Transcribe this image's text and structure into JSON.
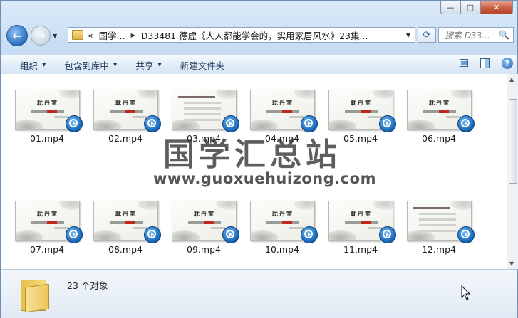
{
  "window": {
    "minimize": "—",
    "maximize": "□",
    "close": "✕"
  },
  "nav": {
    "back_glyph": "←",
    "forward_glyph": "→",
    "history_dropdown": "▼"
  },
  "address": {
    "overflow": "«",
    "segments": [
      "国学...",
      "D33481 德虚《人人都能学会的，实用家居风水》23集..."
    ],
    "separator": "▶",
    "dropdown": "▼"
  },
  "refresh_glyph": "⟳",
  "search": {
    "placeholder": "搜索 D33...",
    "icon": "🔍"
  },
  "toolbar": {
    "organize": "组织",
    "include_in_library": "包含到库中",
    "share": "共享",
    "new_folder": "新建文件夹",
    "caret": "▼",
    "help": "?"
  },
  "files": [
    {
      "name": "01.mp4",
      "style": "title"
    },
    {
      "name": "02.mp4",
      "style": "title"
    },
    {
      "name": "03.mp4",
      "style": "text"
    },
    {
      "name": "04.mp4",
      "style": "title"
    },
    {
      "name": "05.mp4",
      "style": "title"
    },
    {
      "name": "06.mp4",
      "style": "title"
    },
    {
      "name": "07.mp4",
      "style": "title"
    },
    {
      "name": "08.mp4",
      "style": "title"
    },
    {
      "name": "09.mp4",
      "style": "title"
    },
    {
      "name": "10.mp4",
      "style": "title"
    },
    {
      "name": "11.mp4",
      "style": "title"
    },
    {
      "name": "12.mp4",
      "style": "text"
    }
  ],
  "thumb_brand": "耽丹堂",
  "watermark": {
    "title": "国学汇总站",
    "url": "www.guoxuehuizong.com"
  },
  "details": {
    "count": "23 个对象"
  }
}
